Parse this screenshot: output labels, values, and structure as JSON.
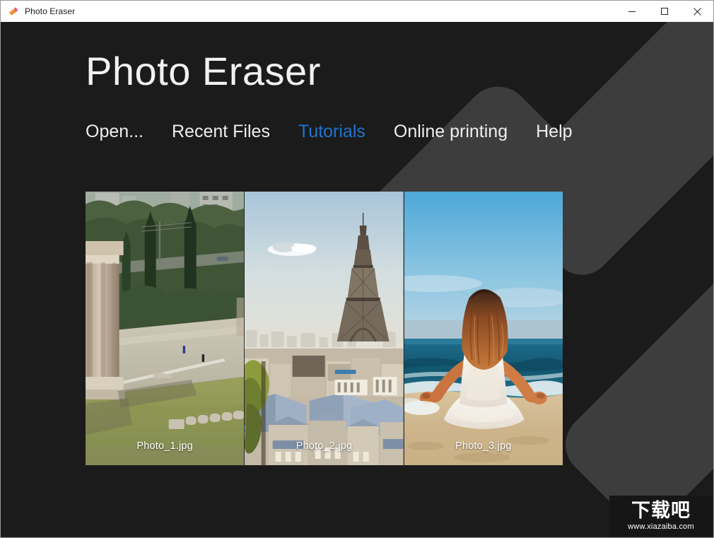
{
  "window": {
    "title": "Photo Eraser",
    "icon": "eraser-icon",
    "background_color": "#1b1b1b",
    "titlebar_color": "#ffffff",
    "controls": [
      {
        "name": "minimize",
        "glyph": "—"
      },
      {
        "name": "maximize",
        "glyph": "□"
      },
      {
        "name": "close",
        "glyph": "✕"
      }
    ]
  },
  "hero": {
    "title": "Photo Eraser"
  },
  "nav": {
    "accent_color": "#1f74d0",
    "items": [
      {
        "label": "Open...",
        "active": false
      },
      {
        "label": "Recent Files",
        "active": false
      },
      {
        "label": "Tutorials",
        "active": true
      },
      {
        "label": "Online printing",
        "active": false
      },
      {
        "label": "Help",
        "active": false
      }
    ]
  },
  "thumbnails": [
    {
      "label": "Photo_1.jpg",
      "description": "Ancient Greek temple ruins with columns, cypress trees and city view"
    },
    {
      "label": "Photo_2.jpg",
      "description": "Paris skyline with the Eiffel Tower and rooftops"
    },
    {
      "label": "Photo_3.jpg",
      "description": "Woman in white dress meditating on a beach facing the sea"
    }
  ],
  "watermark": {
    "text_cn": "下载吧",
    "url": "www.xiazaiba.com"
  }
}
